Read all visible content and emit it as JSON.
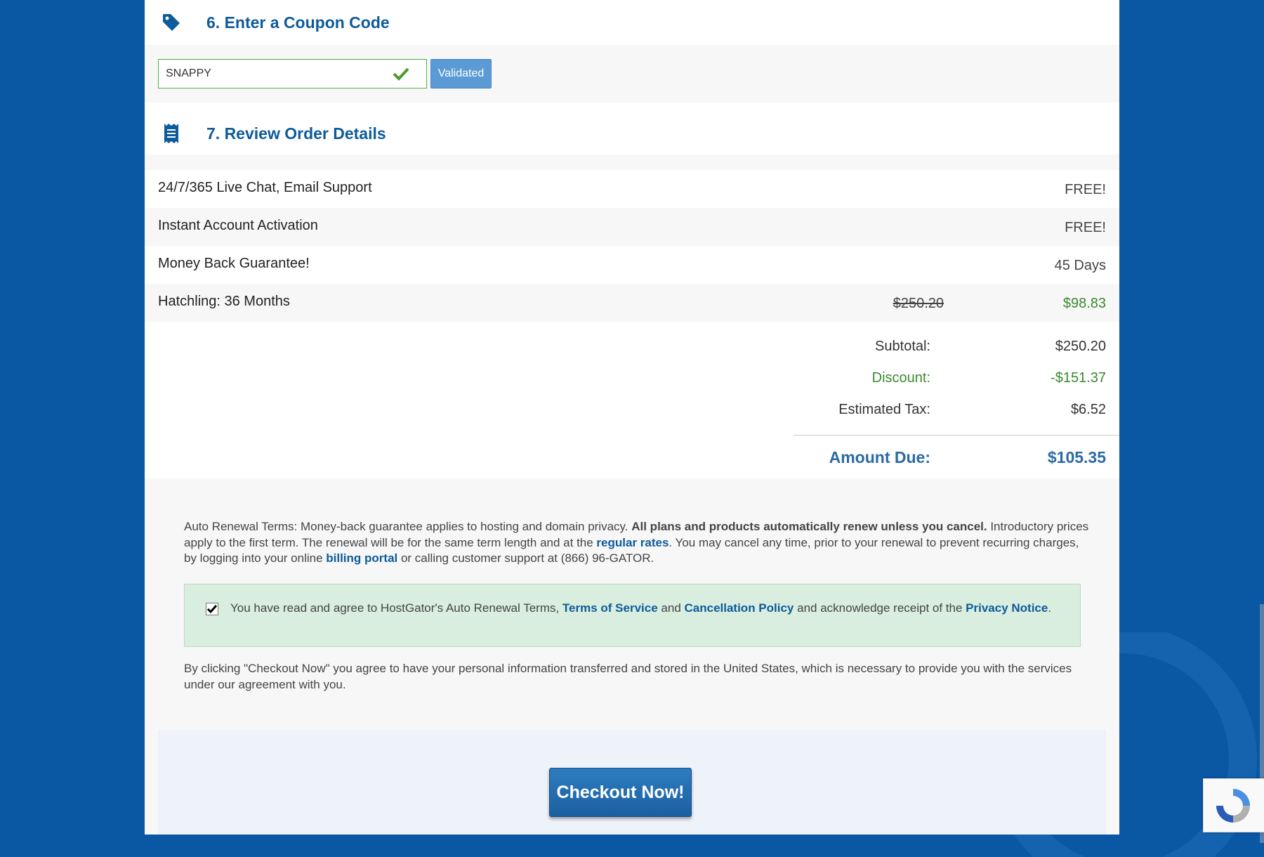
{
  "coupon": {
    "section_title": "6. Enter a Coupon Code",
    "input_value": "SNAPPY",
    "validated_label": "Validated"
  },
  "review": {
    "section_title": "7. Review Order Details",
    "items": [
      {
        "label": "24/7/365 Live Chat, Email Support",
        "value": "FREE!"
      },
      {
        "label": "Instant Account Activation",
        "value": "FREE!"
      },
      {
        "label": "Money Back Guarantee!",
        "value": "45 Days"
      },
      {
        "label": "Hatchling: 36 Months",
        "original_price": "$250.20",
        "value": "$98.83"
      }
    ],
    "totals": {
      "subtotal_label": "Subtotal:",
      "subtotal_value": "$250.20",
      "discount_label": "Discount:",
      "discount_value": "-$151.37",
      "tax_label": "Estimated Tax:",
      "tax_value": "$6.52",
      "amount_due_label": "Amount Due:",
      "amount_due_value": "$105.35"
    }
  },
  "terms": {
    "lead": "Auto Renewal Terms: Money-back guarantee applies to hosting and domain privacy. ",
    "bold": "All plans and products automatically renew unless you cancel.",
    "part2": " Introductory prices apply to the first term. The renewal will be for the same term length and at the ",
    "regular_rates_link": "regular rates",
    "part3": ". You may cancel any time, prior to your renewal to prevent recurring charges, by logging into your online ",
    "billing_portal_link": "billing portal",
    "part4": " or calling customer support at (866) 96-GATOR."
  },
  "agreement": {
    "checked": true,
    "text1": "You have read and agree to HostGator's Auto Renewal Terms, ",
    "tos_link": "Terms of Service",
    "text2": " and ",
    "cancellation_link": "Cancellation Policy",
    "text3": " and acknowledge receipt of the ",
    "privacy_link": "Privacy Notice",
    "text4": "."
  },
  "consent_text": "By clicking \"Checkout Now\" you agree to have your personal information transferred and stored in the United States, which is necessary to provide you with the services under our agreement with you.",
  "checkout_label": "Checkout Now!",
  "colors": {
    "background": "#0a57a4",
    "heading": "#0d5b9a",
    "discount_green": "#3a8a2e",
    "agree_box": "#d9eedf",
    "checkout_button": "#2370b3"
  }
}
